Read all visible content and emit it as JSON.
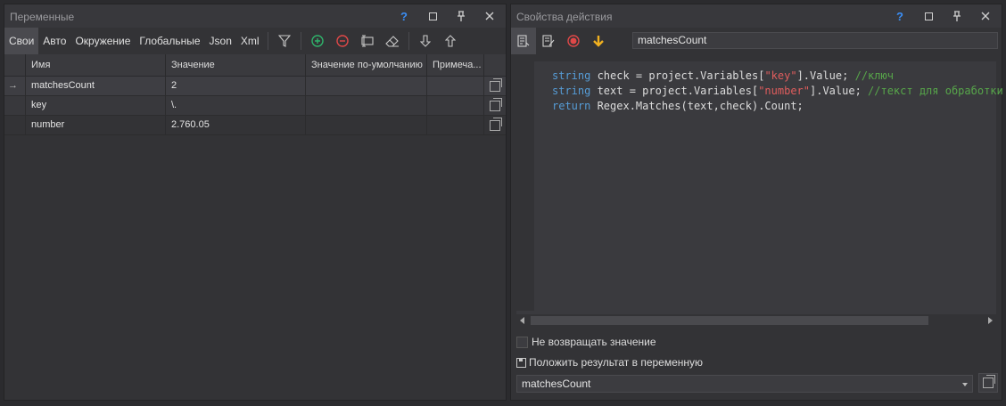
{
  "left_panel": {
    "title": "Переменные",
    "title_buttons": {
      "help": "?",
      "pin": "📌",
      "close": "✕"
    },
    "tabs": [
      "Свои",
      "Авто",
      "Окружение",
      "Глобальные",
      "Json",
      "Xml"
    ],
    "active_tab": "Свои",
    "columns": [
      "Имя",
      "Значение",
      "Значение по-умолчанию",
      "Примеча..."
    ],
    "rows": [
      {
        "marker": "→",
        "name": "matchesCount",
        "value": "2",
        "default": "",
        "note": ""
      },
      {
        "marker": "",
        "name": "key",
        "value": "\\.",
        "default": "",
        "note": ""
      },
      {
        "marker": "",
        "name": "number",
        "value": "2.760.05",
        "default": "",
        "note": ""
      }
    ]
  },
  "right_panel": {
    "title": "Свойства действия",
    "title_buttons": {
      "help": "?",
      "pin": "📌",
      "close": "✕"
    },
    "action_name": "matchesCount",
    "code_lines": [
      [
        {
          "t": "kw",
          "v": "string"
        },
        {
          "t": "p",
          "v": " check = project.Variables["
        },
        {
          "t": "str",
          "v": "\"key\""
        },
        {
          "t": "p",
          "v": "].Value; "
        },
        {
          "t": "cm",
          "v": "//ключ"
        }
      ],
      [
        {
          "t": "kw",
          "v": "string"
        },
        {
          "t": "p",
          "v": " text = project.Variables["
        },
        {
          "t": "str",
          "v": "\"number\""
        },
        {
          "t": "p",
          "v": "].Value; "
        },
        {
          "t": "cm",
          "v": "//текст для обработки"
        }
      ],
      [
        {
          "t": "kw",
          "v": "return"
        },
        {
          "t": "p",
          "v": " Regex.Matches(text,check).Count;"
        }
      ]
    ],
    "no_return_label": "Не возвращать значение",
    "save_result_label": "Положить результат в переменную",
    "result_variable": "matchesCount"
  },
  "colors": {
    "accent_blue": "#3a8ef6",
    "add_green": "#2fb36b",
    "remove_red": "#e04848",
    "arrow_yellow": "#f0b020"
  }
}
